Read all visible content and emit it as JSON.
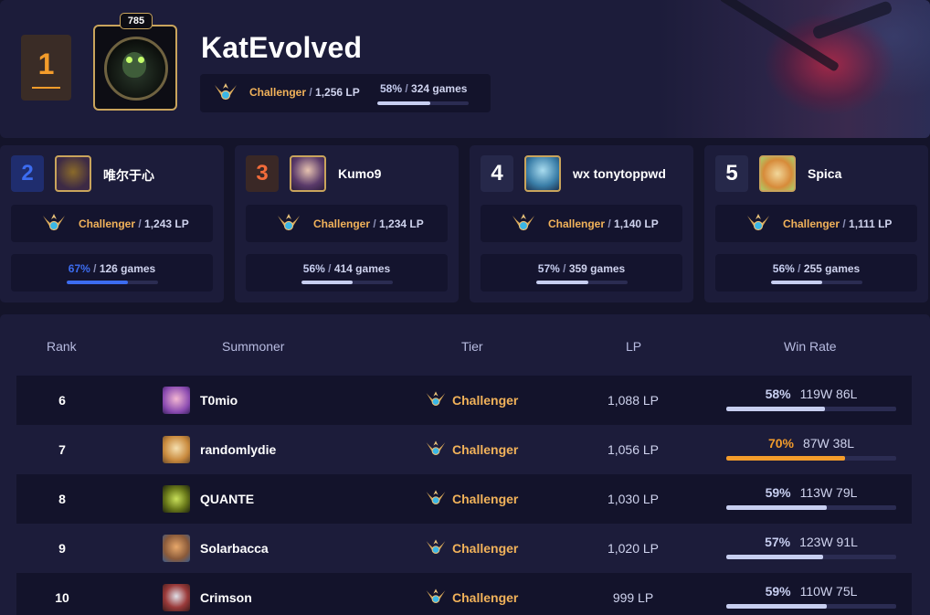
{
  "colors": {
    "accent_orange": "#f39c2b",
    "tier_gold": "#f1b25a",
    "rank2_blue": "#3c6cf0",
    "rank3_orange": "#f26b3a",
    "bar_default": "#c7cef0",
    "bar_hot": "#f39c2b"
  },
  "top": {
    "rank": "1",
    "level": "785",
    "name": "KatEvolved",
    "tier": "Challenger",
    "lp": "1,256 LP",
    "winrate": "58%",
    "games": "324 games",
    "winrate_value": 0.58
  },
  "runners_up": [
    {
      "rank": "2",
      "name": "唯尔于心",
      "tier": "Challenger",
      "lp": "1,243 LP",
      "winrate": "67%",
      "games": "126 games",
      "winrate_value": 0.67
    },
    {
      "rank": "3",
      "name": "Kumo9",
      "tier": "Challenger",
      "lp": "1,234 LP",
      "winrate": "56%",
      "games": "414 games",
      "winrate_value": 0.56
    },
    {
      "rank": "4",
      "name": "wx tonytoppwd",
      "tier": "Challenger",
      "lp": "1,140 LP",
      "winrate": "57%",
      "games": "359 games",
      "winrate_value": 0.57
    },
    {
      "rank": "5",
      "name": "Spica",
      "tier": "Challenger",
      "lp": "1,111 LP",
      "winrate": "56%",
      "games": "255 games",
      "winrate_value": 0.56
    }
  ],
  "table": {
    "headers": {
      "rank": "Rank",
      "summoner": "Summoner",
      "tier": "Tier",
      "lp": "LP",
      "winrate": "Win Rate"
    },
    "rows": [
      {
        "rank": "6",
        "name": "T0mio",
        "tier": "Challenger",
        "lp": "1,088 LP",
        "winrate": "58%",
        "wl": "119W 86L",
        "winrate_value": 0.58
      },
      {
        "rank": "7",
        "name": "randomlydie",
        "tier": "Challenger",
        "lp": "1,056 LP",
        "winrate": "70%",
        "wl": "87W 38L",
        "winrate_value": 0.7
      },
      {
        "rank": "8",
        "name": "QUANTE",
        "tier": "Challenger",
        "lp": "1,030 LP",
        "winrate": "59%",
        "wl": "113W 79L",
        "winrate_value": 0.59
      },
      {
        "rank": "9",
        "name": "Solarbacca",
        "tier": "Challenger",
        "lp": "1,020 LP",
        "winrate": "57%",
        "wl": "123W 91L",
        "winrate_value": 0.57
      },
      {
        "rank": "10",
        "name": "Crimson",
        "tier": "Challenger",
        "lp": "999 LP",
        "winrate": "59%",
        "wl": "110W 75L",
        "winrate_value": 0.59
      }
    ]
  }
}
